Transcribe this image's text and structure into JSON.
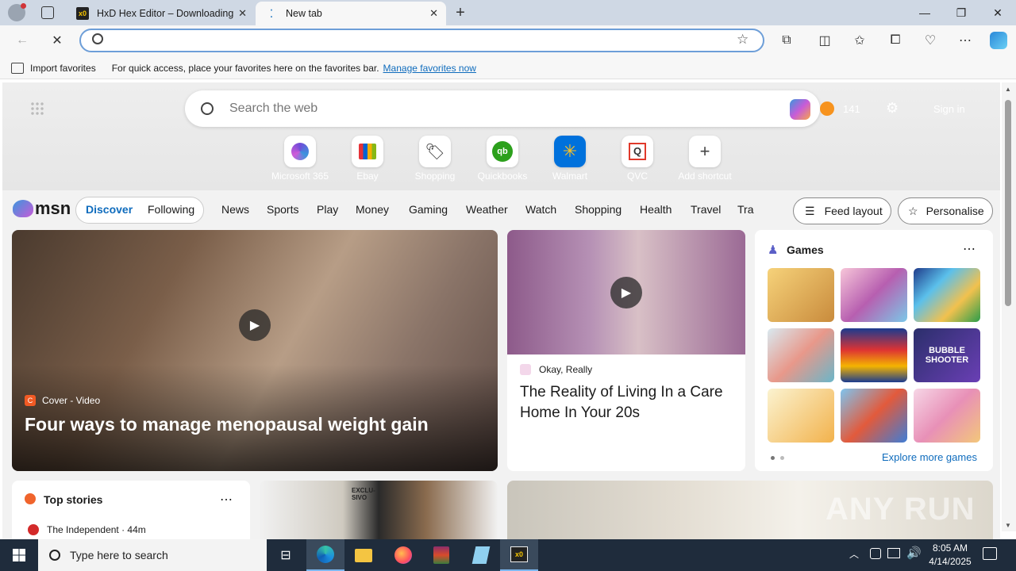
{
  "tabs": [
    {
      "title": "HxD Hex Editor – Downloading"
    },
    {
      "title": "New tab"
    }
  ],
  "address": {
    "placeholder": ""
  },
  "favbar": {
    "import": "Import favorites",
    "hint": "For quick access, place your favorites here on the favorites bar.",
    "manage": "Manage favorites now"
  },
  "ntp": {
    "search_placeholder": "Search the web",
    "points": "141",
    "sign_in": "Sign in",
    "shortcuts": [
      {
        "label": "Microsoft 365",
        "icon": "m365-icon"
      },
      {
        "label": "Ebay",
        "icon": "ebay-icon"
      },
      {
        "label": "Shopping",
        "icon": "shopping-tag-icon"
      },
      {
        "label": "Quickbooks",
        "icon": "quickbooks-icon"
      },
      {
        "label": "Walmart",
        "icon": "walmart-icon"
      },
      {
        "label": "QVC",
        "icon": "qvc-icon"
      },
      {
        "label": "Add shortcut",
        "icon": "plus-icon"
      }
    ]
  },
  "msn": {
    "logo": "msn",
    "discover": "Discover",
    "following": "Following",
    "nav": [
      "News",
      "Sports",
      "Play",
      "Money",
      "Gaming",
      "Weather",
      "Watch",
      "Shopping",
      "Health",
      "Travel",
      "Tra"
    ],
    "feed_layout": "Feed layout",
    "personalise": "Personalise"
  },
  "cards": {
    "main": {
      "source": "Cover - Video",
      "headline": "Four ways to manage menopausal weight gain"
    },
    "second": {
      "source": "Okay, Really",
      "headline": "The Reality of Living In a Care Home In Your 20s"
    },
    "games": {
      "title": "Games",
      "explore": "Explore more games",
      "bubble_text": "BUBBLE SHOOTER"
    },
    "top_stories": {
      "title": "Top stories",
      "source": "The Independent · 44m"
    },
    "promo": {
      "text": "EXCLU-SIVO"
    }
  },
  "watermark": "ANY RUN",
  "taskbar": {
    "search_placeholder": "Type here to search",
    "time": "8:05 AM",
    "date": "4/14/2025"
  },
  "colors": {
    "accent": "#0f6cbd",
    "taskbar": "#1f2c3c",
    "titlebar": "#cfd8e4"
  }
}
